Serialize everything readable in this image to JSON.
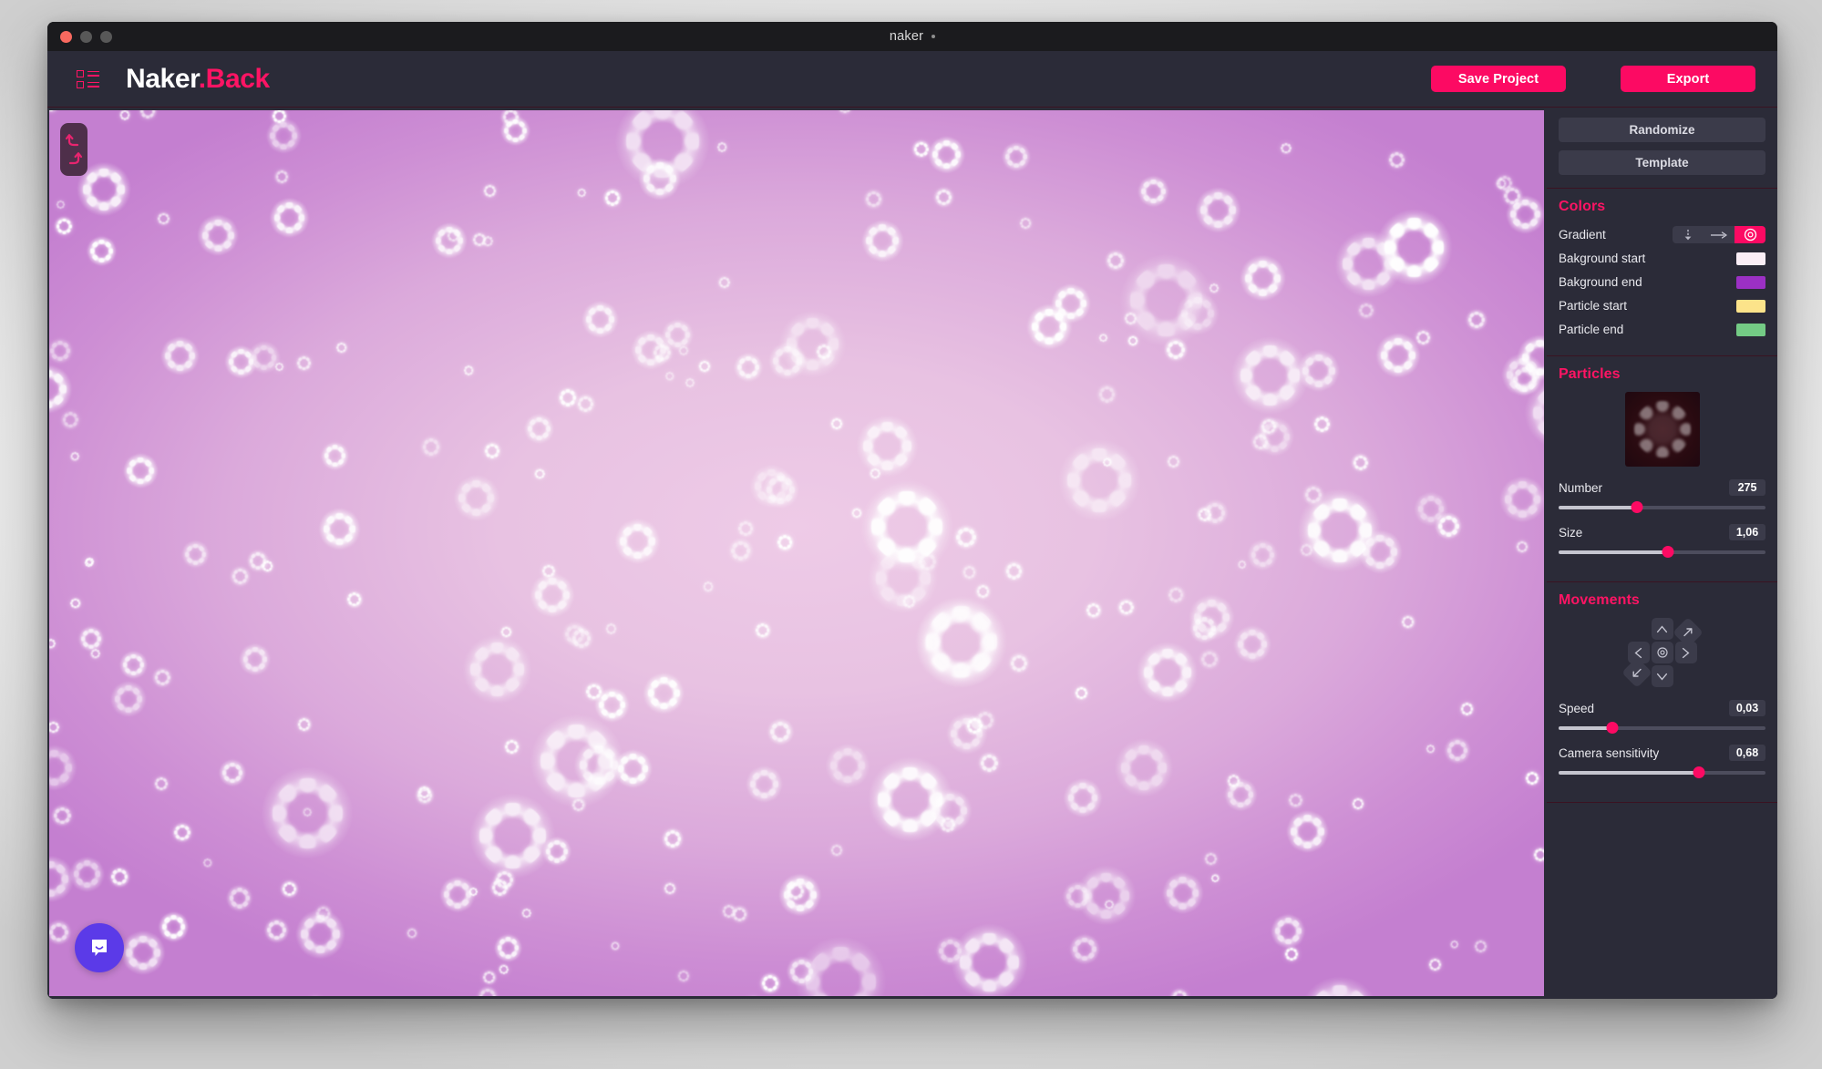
{
  "window": {
    "title": "naker",
    "modified_indicator": "·",
    "controls": [
      "close",
      "minimize",
      "maximize"
    ]
  },
  "topbar": {
    "menu_icon": "list-menu-icon",
    "logo_main": "Naker",
    "logo_accent": ".Back",
    "save_label": "Save Project",
    "export_label": "Export"
  },
  "canvas": {
    "undo_icon": "undo-arrow-icon",
    "redo_icon": "redo-arrow-icon",
    "intercom_icon": "chat-bubble-icon",
    "background_center": "#EECBE7",
    "background_edge": "#C47FD0",
    "particle_color": "#FFFFFF"
  },
  "sidebar": {
    "actions": {
      "randomize_label": "Randomize",
      "template_label": "Template"
    },
    "colors": {
      "title": "Colors",
      "gradient_label": "Gradient",
      "gradient_modes": [
        {
          "name": "vertical",
          "icon": "arrow-down-icon",
          "selected": false
        },
        {
          "name": "horizontal",
          "icon": "arrow-right-icon",
          "selected": false
        },
        {
          "name": "radial",
          "icon": "target-icon",
          "selected": true
        }
      ],
      "swatches": [
        {
          "label": "Bakground start",
          "color": "#FAEEF6"
        },
        {
          "label": "Bakground end",
          "color": "#9B30C4"
        },
        {
          "label": "Particle start",
          "color": "#FCE38A"
        },
        {
          "label": "Particle end",
          "color": "#74CB85"
        }
      ]
    },
    "particles": {
      "title": "Particles",
      "preview_icon": "particle-shape-preview",
      "number_label": "Number",
      "number_value": "275",
      "number_percent": 38,
      "size_label": "Size",
      "size_value": "1,06",
      "size_percent": 53
    },
    "movements": {
      "title": "Movements",
      "dpad": [
        {
          "name": "move-up-button",
          "icon": "chevron-up-icon"
        },
        {
          "name": "move-left-button",
          "icon": "chevron-left-icon"
        },
        {
          "name": "move-center-button",
          "icon": "target-icon"
        },
        {
          "name": "move-right-button",
          "icon": "chevron-right-icon"
        },
        {
          "name": "move-down-button",
          "icon": "chevron-down-icon"
        },
        {
          "name": "move-up-right-button",
          "icon": "arrow-up-right-icon"
        },
        {
          "name": "move-down-left-button",
          "icon": "arrow-down-left-icon"
        }
      ],
      "speed_label": "Speed",
      "speed_value": "0,03",
      "speed_percent": 26,
      "camera_label": "Camera sensitivity",
      "camera_value": "0,68",
      "camera_percent": 68
    }
  },
  "theme": {
    "accent_pink": "#FC0A63",
    "panel_bg": "#2B2B38",
    "control_bg": "#3B3B4A",
    "divider": "#3A1322",
    "intercom_purple": "#5B3AE8"
  }
}
